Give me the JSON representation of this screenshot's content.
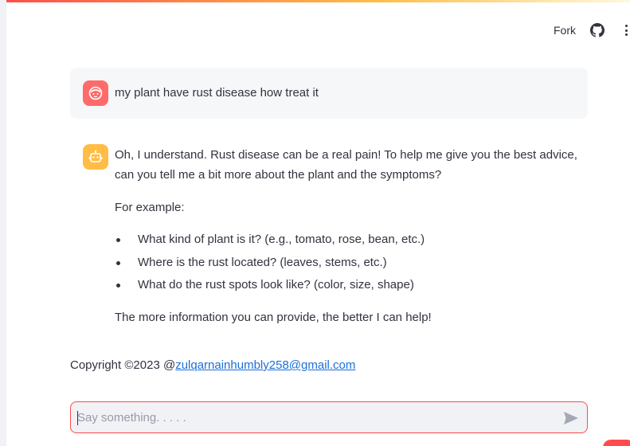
{
  "header": {
    "fork_label": "Fork",
    "github_icon": "github-icon",
    "menu_icon": "more-vertical-icon"
  },
  "chat": {
    "user_message": {
      "avatar_icon": "user-face-icon",
      "avatar_color": "#ff6b6b",
      "text": "my plant have rust disease how treat it"
    },
    "assistant_message": {
      "avatar_icon": "robot-icon",
      "avatar_color": "#ffbd45",
      "intro": "Oh, I understand. Rust disease can be a real pain! To help me give you the best advice, can you tell me a bit more about the plant and the symptoms?",
      "example_label": "For example:",
      "bullets": [
        "What kind of plant is it? (e.g., tomato, rose, bean, etc.)",
        "Where is the rust located? (leaves, stems, etc.)",
        "What do the rust spots look like? (color, size, shape)"
      ],
      "closing": "The more information you can provide, the better I can help!"
    }
  },
  "footer": {
    "copyright_prefix": "Copyright ©2023 @",
    "email_link": "zulqarnainhumbly258@gmail.com"
  },
  "input": {
    "placeholder": "Say something. . . . .",
    "value": "",
    "send_icon": "send-icon"
  },
  "colors": {
    "accent": "#ff4b4b",
    "link": "#1c6fd6",
    "text": "#31333f"
  }
}
